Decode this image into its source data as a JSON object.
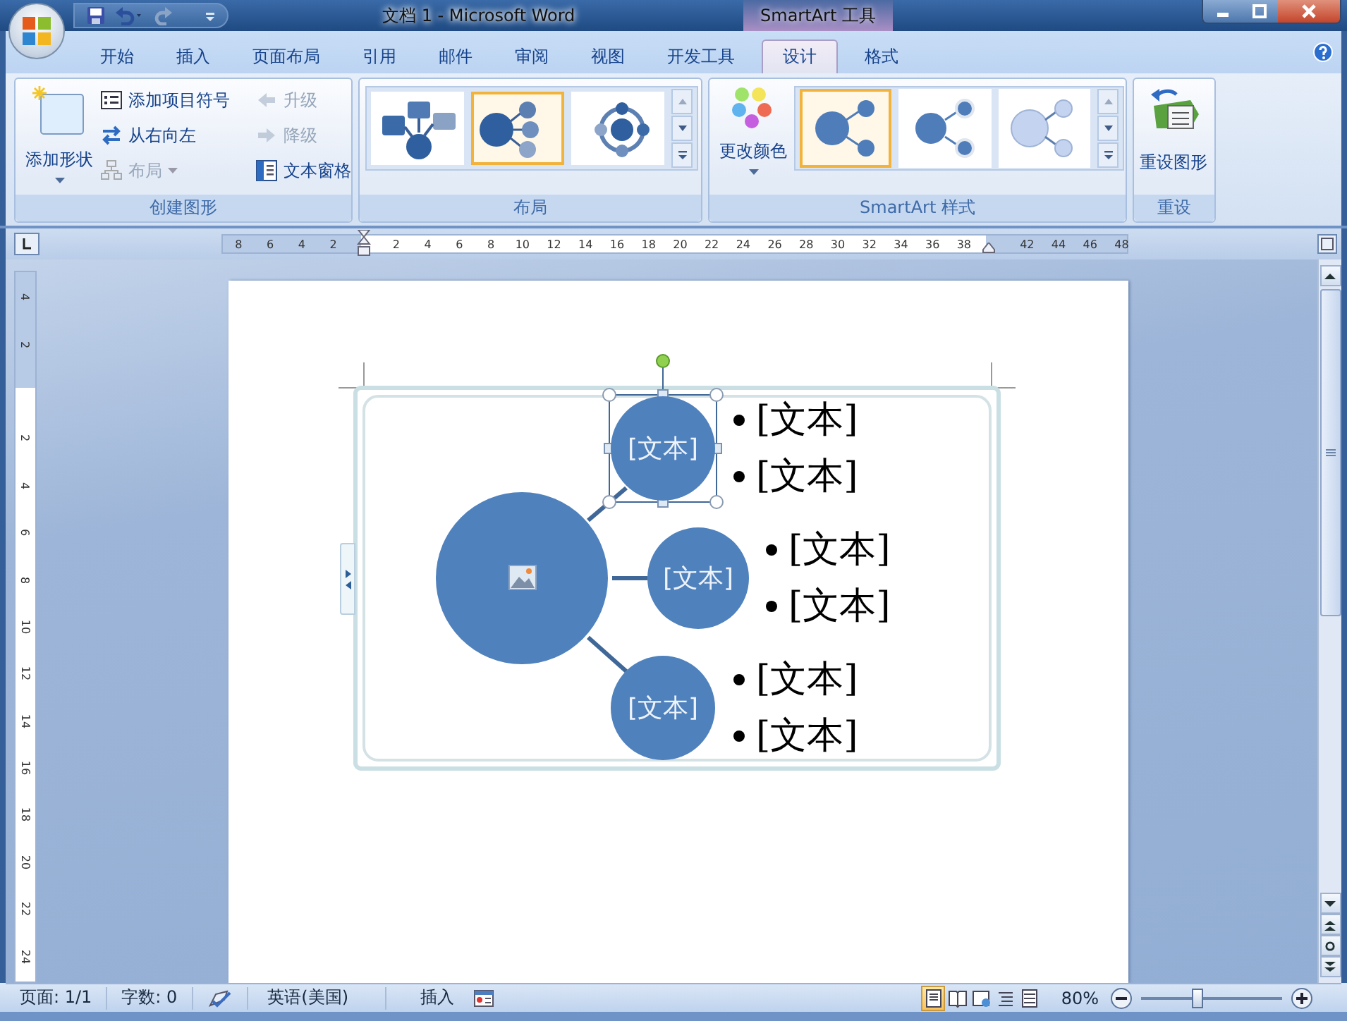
{
  "window": {
    "title": "文档 1 - Microsoft Word",
    "context_group": "SmartArt 工具"
  },
  "ribbon_tabs": [
    {
      "label": "开始",
      "selected": false
    },
    {
      "label": "插入",
      "selected": false
    },
    {
      "label": "页面布局",
      "selected": false
    },
    {
      "label": "引用",
      "selected": false
    },
    {
      "label": "邮件",
      "selected": false
    },
    {
      "label": "审阅",
      "selected": false
    },
    {
      "label": "视图",
      "selected": false
    },
    {
      "label": "开发工具",
      "selected": false
    },
    {
      "label": "设计",
      "selected": true
    },
    {
      "label": "格式",
      "selected": false
    }
  ],
  "create_graphic": {
    "title": "创建图形",
    "add_shape": "添加形状",
    "column_1": [
      {
        "kind": "bullet",
        "label": "添加项目符号",
        "disabled": false
      },
      {
        "kind": "rtl",
        "label": "从右向左",
        "disabled": false
      },
      {
        "kind": "layout",
        "label": "布局",
        "disabled": true
      }
    ],
    "column_2": [
      {
        "kind": "promote",
        "label": "升级",
        "disabled": true
      },
      {
        "kind": "demote",
        "label": "降级",
        "disabled": true
      },
      {
        "kind": "pane",
        "label": "文本窗格",
        "disabled": false
      }
    ]
  },
  "layouts": {
    "title": "布局",
    "items": [
      {
        "kind": "converging",
        "selected": false
      },
      {
        "kind": "bubble",
        "selected": true
      },
      {
        "kind": "cycle",
        "selected": false
      }
    ]
  },
  "styles": {
    "title": "SmartArt 样式",
    "change_colors": "更改颜色",
    "items": [
      {
        "kind": "flat",
        "selected": true
      },
      {
        "kind": "outlined",
        "selected": false
      },
      {
        "kind": "gradient",
        "selected": false
      }
    ]
  },
  "reset": {
    "title": "重设",
    "button": "重设图形"
  },
  "ruler": {
    "left_numbers": [
      "8",
      "6",
      "4",
      "2"
    ],
    "numbers": [
      "2",
      "4",
      "6",
      "8",
      "10",
      "12",
      "14",
      "16",
      "18",
      "20",
      "22",
      "24",
      "26",
      "28",
      "30",
      "32",
      "34",
      "36",
      "38"
    ],
    "right_numbers": [
      "42",
      "44",
      "46",
      "48"
    ]
  },
  "vertical_ruler": {
    "top_numbers": [
      "4",
      "2"
    ],
    "numbers": [
      "2",
      "4",
      "6",
      "8",
      "10",
      "12",
      "14",
      "16",
      "18",
      "20",
      "22",
      "24"
    ]
  },
  "diagram": {
    "nodes": [
      {
        "label": "[文本]",
        "selected": true,
        "bullets": [
          "[文本]",
          "[文本]"
        ]
      },
      {
        "label": "[文本]",
        "selected": false,
        "bullets": [
          "[文本]",
          "[文本]"
        ]
      },
      {
        "label": "[文本]",
        "selected": false,
        "bullets": [
          "[文本]",
          "[文本]"
        ]
      }
    ]
  },
  "status_bar": {
    "page": "页面: 1/1",
    "words": "字数: 0",
    "language": "英语(美国)",
    "mode": "插入",
    "views": [
      {
        "kind": "print",
        "selected": true
      },
      {
        "kind": "reading",
        "selected": false
      },
      {
        "kind": "web",
        "selected": false
      },
      {
        "kind": "outline",
        "selected": false
      },
      {
        "kind": "draft",
        "selected": false
      }
    ],
    "zoom": "80%",
    "zoom_slider": {
      "level": 0.4
    }
  }
}
